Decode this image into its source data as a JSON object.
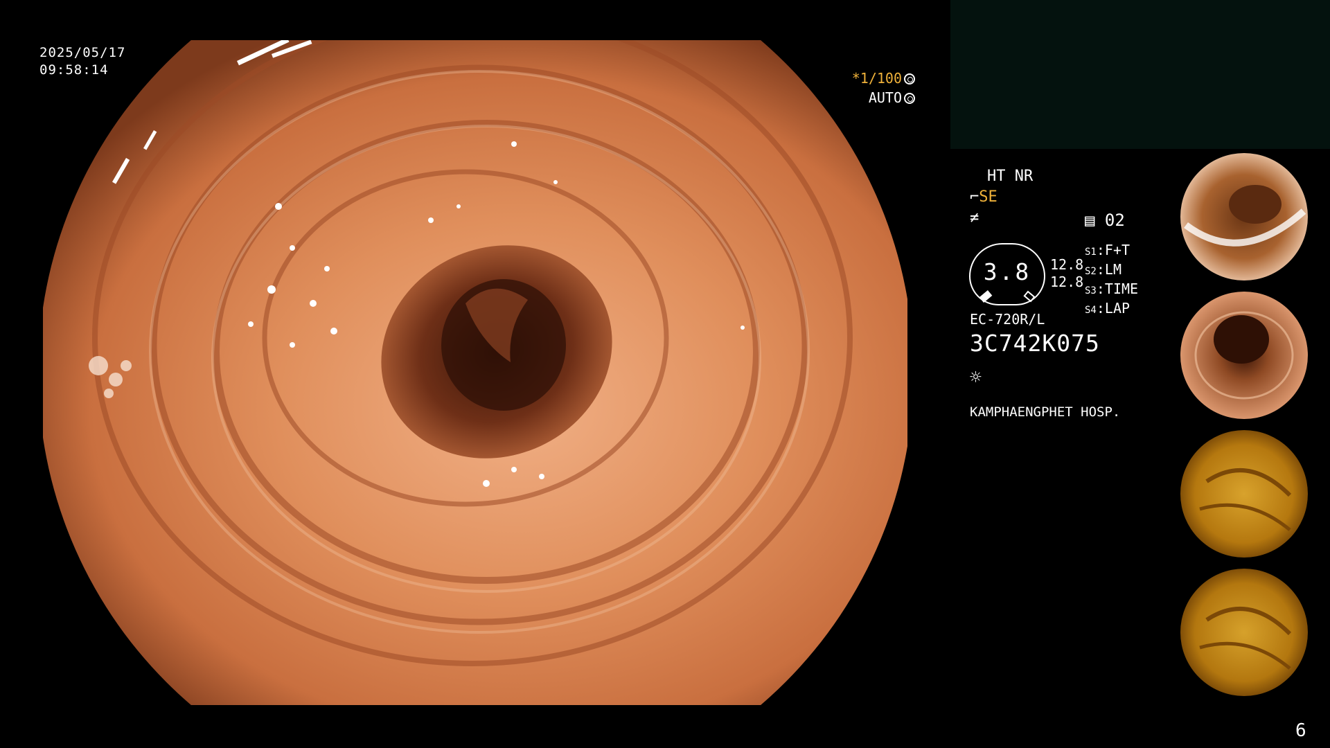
{
  "overlay": {
    "date": "2025/05/17",
    "time": "09:58:14",
    "shutter": "1/100",
    "shutter_prefix": "*",
    "exposure_mode": "AUTO"
  },
  "panel": {
    "ht_nr": "HT NR",
    "mode": "SE",
    "channel": "02",
    "gauge_value": "3.8",
    "side_values": [
      "12.8",
      "12.8"
    ],
    "s_buttons": [
      {
        "key": "S1",
        "label": "F+T"
      },
      {
        "key": "S2",
        "label": "LM"
      },
      {
        "key": "S3",
        "label": "TIME"
      },
      {
        "key": "S4",
        "label": "LAP"
      }
    ],
    "scope_model": "EC-720R/L",
    "scope_serial": "3C742K075",
    "hospital": "KAMPHAENGPHET HOSP."
  },
  "thumbnails": [
    {
      "name": "capture-1",
      "tone": "#c77b47"
    },
    {
      "name": "capture-2",
      "tone": "#c9774a"
    },
    {
      "name": "capture-3",
      "tone": "#c8901c"
    },
    {
      "name": "capture-4",
      "tone": "#c78f1d"
    }
  ],
  "page_number": "6"
}
